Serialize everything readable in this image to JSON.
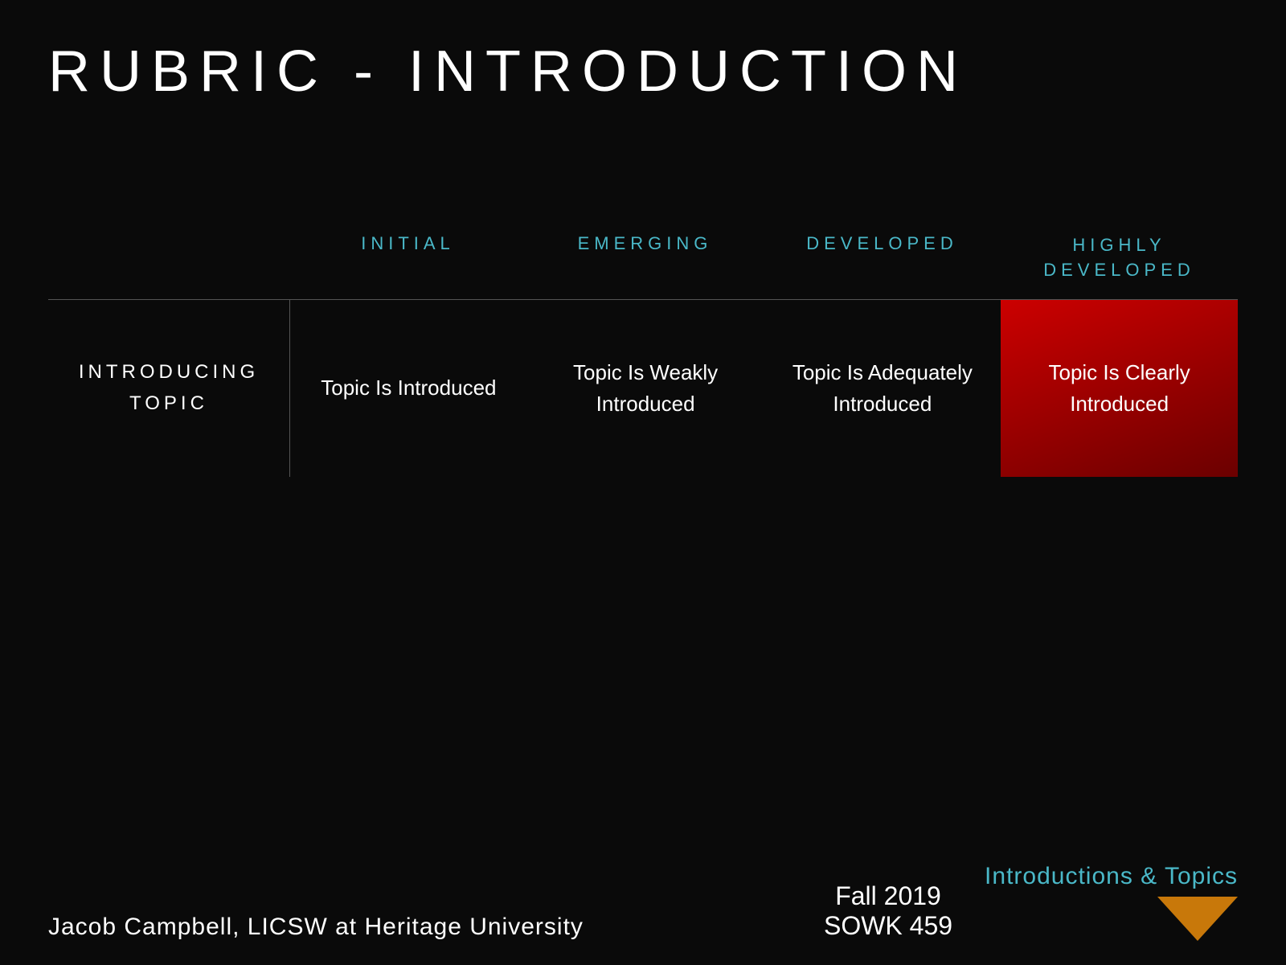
{
  "page": {
    "title": "RUBRIC - INTRODUCTION",
    "background_color": "#0a0a0a"
  },
  "header_row": {
    "columns": [
      {
        "id": "initial",
        "label": "INITIAL"
      },
      {
        "id": "emerging",
        "label": "EMERGING"
      },
      {
        "id": "developed",
        "label": "DEVELOPED"
      },
      {
        "id": "highly_developed",
        "label": "HIGHLY\nDEVELOPED",
        "multiline": true
      }
    ]
  },
  "rubric_rows": [
    {
      "id": "introducing_topic",
      "label": "INTRODUCING\nTOPIC",
      "cells": [
        {
          "id": "initial_cell",
          "text": "Topic Is Introduced",
          "highlighted": false
        },
        {
          "id": "emerging_cell",
          "text": "Topic Is Weakly\nIntroduced",
          "highlighted": false
        },
        {
          "id": "developed_cell",
          "text": "Topic Is Adequately\nIntroduced",
          "highlighted": false
        },
        {
          "id": "highly_developed_cell",
          "text": "Topic Is Clearly\nIntroduced",
          "highlighted": true
        }
      ]
    }
  ],
  "footer": {
    "author": "Jacob Campbell, LICSW at Heritage University",
    "course_title": "Fall 2019",
    "course_code": "SOWK 459",
    "topic": "Introductions & Topics"
  }
}
